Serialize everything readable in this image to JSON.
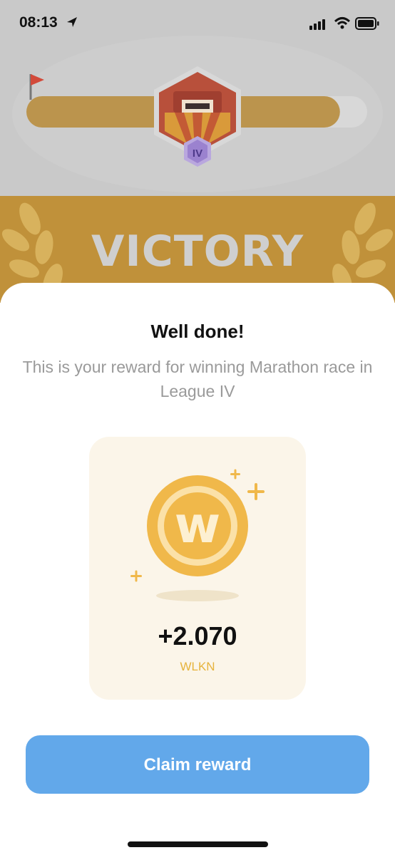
{
  "status_bar": {
    "time": "08:13"
  },
  "league": {
    "badge": "IV",
    "progress_percent": 92
  },
  "banner": {
    "title": "VICTORY"
  },
  "reward": {
    "headline": "Well done!",
    "subtitle": "This is your reward for winning Marathon race in League IV",
    "amount": "+2.070",
    "currency": "WLKN",
    "coin_glyph": "w"
  },
  "actions": {
    "claim_label": "Claim reward"
  },
  "colors": {
    "gold": "#c0913a",
    "coin": "#f0b84a",
    "button": "#62a8ea",
    "track": "#bb944d",
    "arena_red": "#b8503b"
  }
}
